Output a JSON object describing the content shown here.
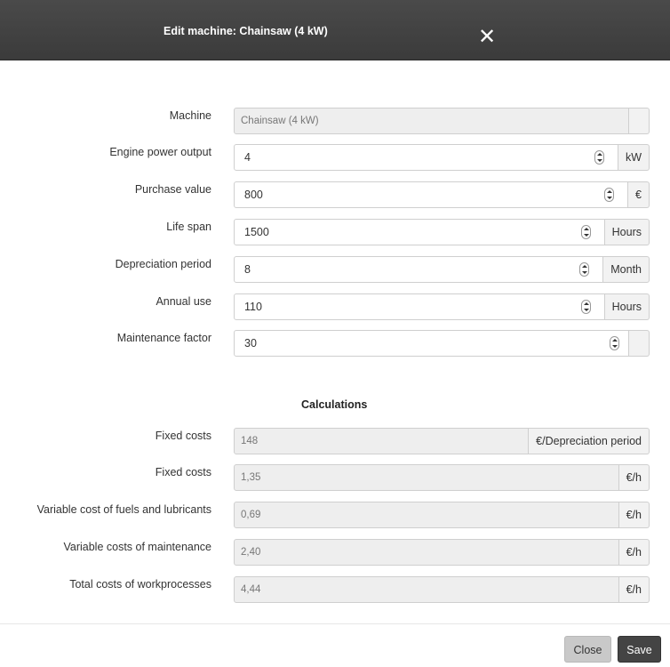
{
  "dialog": {
    "title": "Edit machine: Chainsaw (4 kW)",
    "close_icon": "close-icon"
  },
  "form": {
    "machine": {
      "label": "Machine",
      "value": "Chainsaw (4 kW)",
      "unit": ""
    },
    "engine_power": {
      "label": "Engine power output",
      "value": "4",
      "unit": "kW"
    },
    "purchase_value": {
      "label": "Purchase value",
      "value": "800",
      "unit": "€"
    },
    "life_span": {
      "label": "Life span",
      "value": "1500",
      "unit": "Hours"
    },
    "depreciation_period": {
      "label": "Depreciation period",
      "value": "8",
      "unit": "Month"
    },
    "annual_use": {
      "label": "Annual use",
      "value": "110",
      "unit": "Hours"
    },
    "maintenance_factor": {
      "label": "Maintenance factor",
      "value": "30",
      "unit": ""
    }
  },
  "calculations": {
    "title": "Calculations",
    "fixed_costs_period": {
      "label": "Fixed costs",
      "value": "148",
      "unit": "€/Depreciation period"
    },
    "fixed_costs_hour": {
      "label": "Fixed costs",
      "value": "1,35",
      "unit": "€/h"
    },
    "variable_fuels": {
      "label": "Variable cost of fuels and lubricants",
      "value": "0,69",
      "unit": "€/h"
    },
    "variable_maintenance": {
      "label": "Variable costs of maintenance",
      "value": "2,40",
      "unit": "€/h"
    },
    "total_costs": {
      "label": "Total costs of workprocesses",
      "value": "4,44",
      "unit": "€/h"
    }
  },
  "footer": {
    "close_label": "Close",
    "save_label": "Save"
  },
  "colors": {
    "header_bg": "#3f3f3f",
    "save_bg": "#444444",
    "readonly_bg": "#eeeeee"
  }
}
